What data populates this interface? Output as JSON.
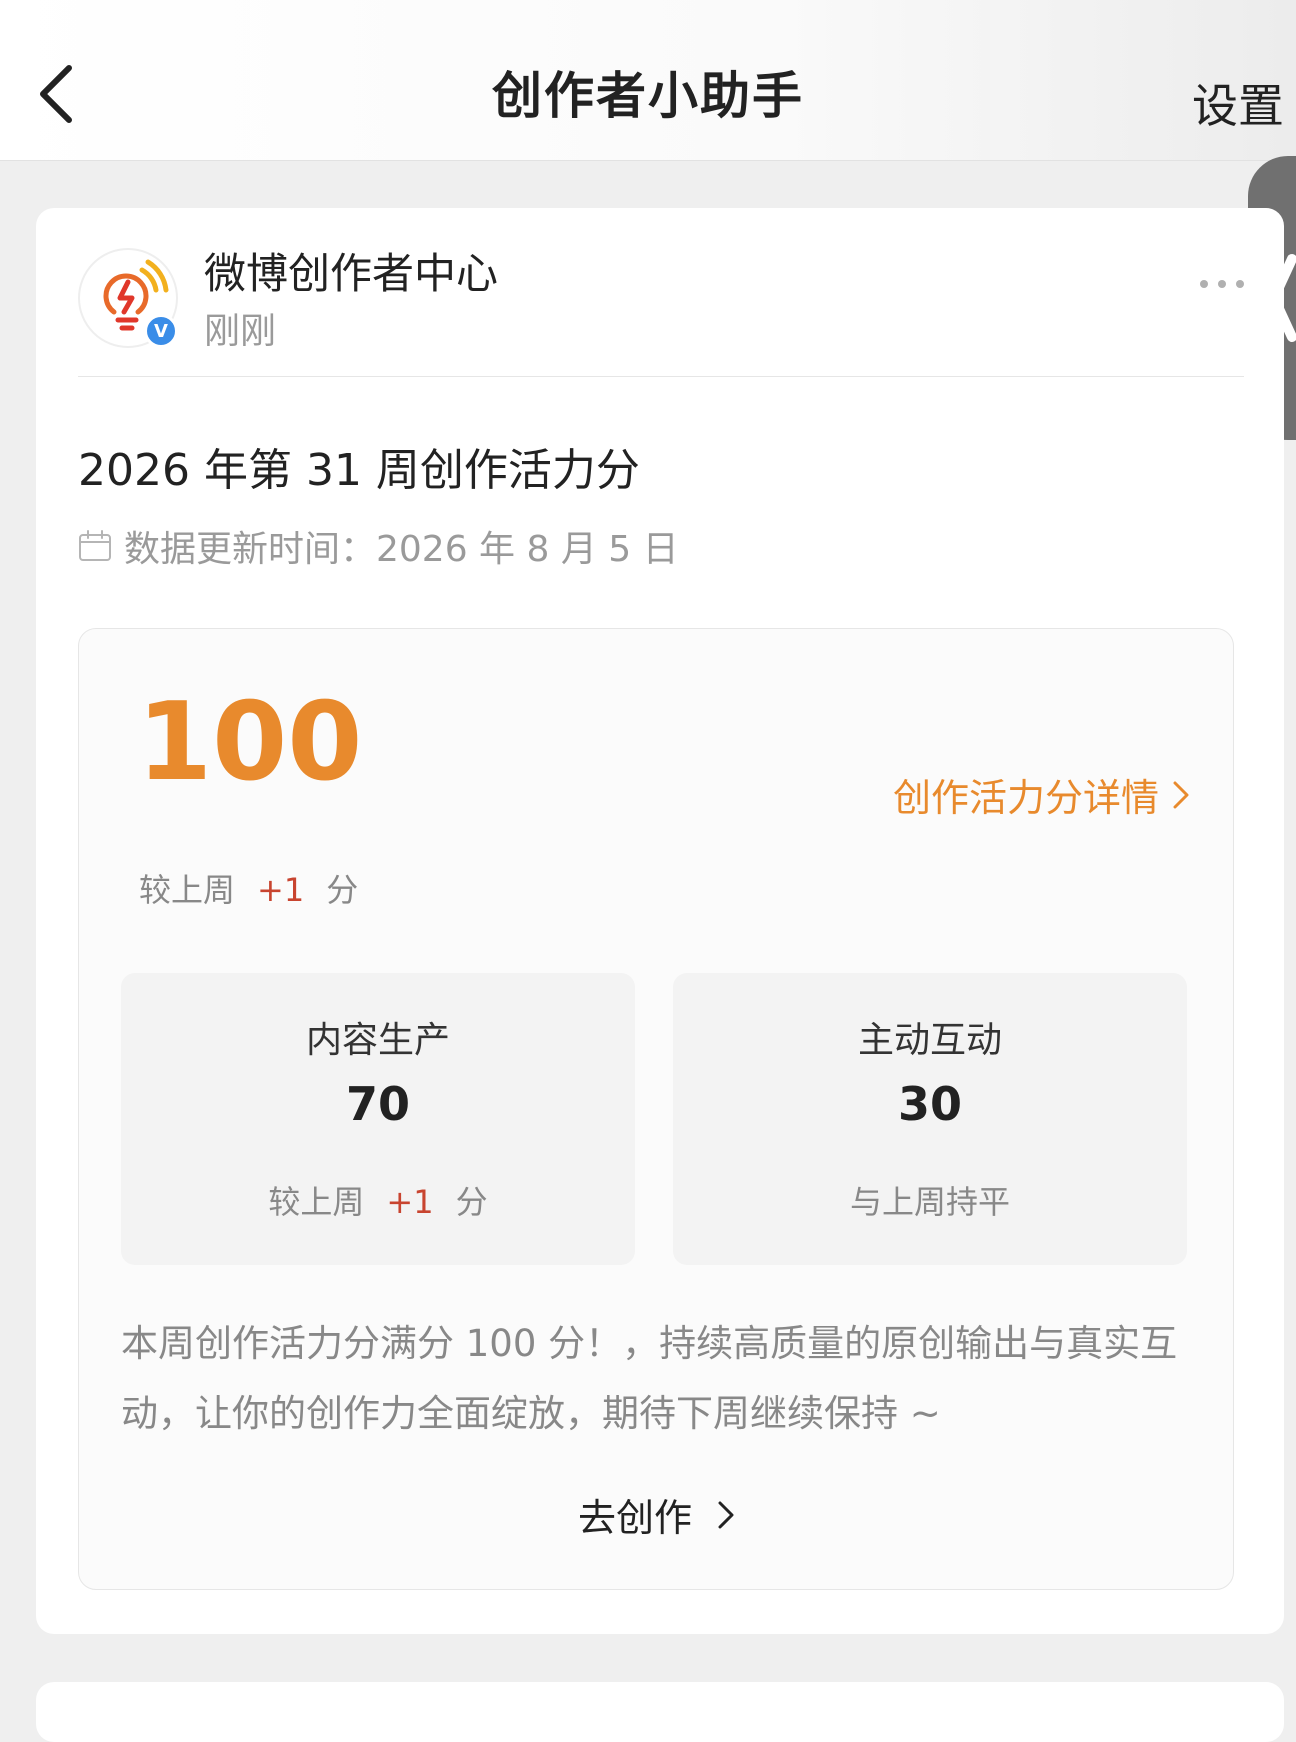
{
  "navbar": {
    "title": "创作者小助手",
    "settings_label": "设置",
    "back_icon": "chevron-left-icon"
  },
  "post": {
    "account_name": "微博创作者中心",
    "time": "刚刚",
    "verified_mark": "V",
    "week_title": "2026 年第 31 周创作活力分",
    "update_time": "数据更新时间：2026 年 8 月 5 日"
  },
  "score": {
    "value": "100",
    "details_link": "创作活力分详情",
    "compare_prefix": "较上周",
    "compare_delta": "+1",
    "compare_unit": "分"
  },
  "metrics": [
    {
      "label": "内容生产",
      "value": "70",
      "compare_prefix": "较上周",
      "compare_delta": "+1",
      "compare_unit": "分"
    },
    {
      "label": "主动互动",
      "value": "30",
      "compare_text": "与上周持平"
    }
  ],
  "summary": "本周创作活力分满分 100 分！，持续高质量的原创输出与真实互动，让你的创作力全面绽放，期待下周继续保持 ~",
  "create_link": "去创作",
  "colors": {
    "accent": "#e88a2d",
    "delta": "#c8442f",
    "verified": "#3a8de8"
  }
}
